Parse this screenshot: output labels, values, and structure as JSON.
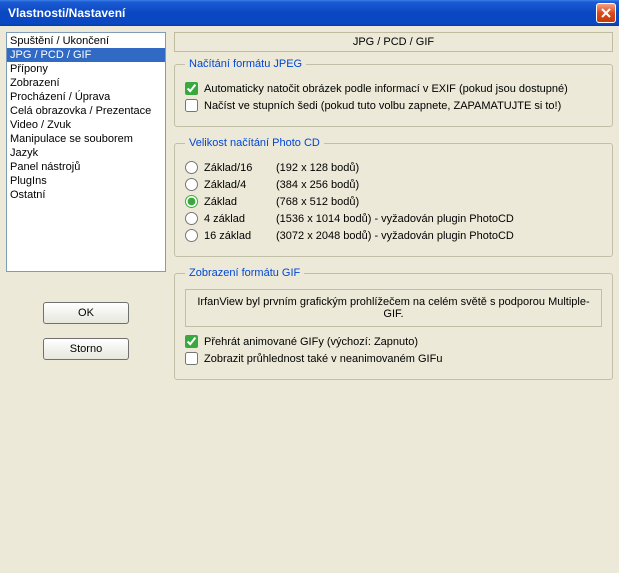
{
  "titlebar": {
    "title": "Vlastnosti/Nastavení"
  },
  "sidebar": {
    "items": [
      "Spuštění / Ukončení",
      "JPG / PCD / GIF",
      "Přípony",
      "Zobrazení",
      "Procházení / Úprava",
      "Celá obrazovka / Prezentace",
      "Video / Zvuk",
      "Manipulace se souborem",
      "Jazyk",
      "Panel nástrojů",
      "PlugIns",
      "Ostatní"
    ],
    "selected_index": 1
  },
  "buttons": {
    "ok": "OK",
    "cancel": "Storno"
  },
  "page": {
    "header": "JPG / PCD / GIF",
    "groups": {
      "jpeg": {
        "legend": "Načítání formátu JPEG",
        "auto_rotate": "Automaticky natočit obrázek podle informací v EXIF (pokud jsou dostupné)",
        "load_gray": "Načíst ve stupních šedi (pokud tuto volbu zapnete, ZAPAMATUJTE si to!)"
      },
      "pcd": {
        "legend": "Velikost načítání Photo CD",
        "options": [
          {
            "label": "Základ/16",
            "size": "(192 x 128 bodů)"
          },
          {
            "label": "Základ/4",
            "size": "(384 x 256 bodů)"
          },
          {
            "label": "Základ",
            "size": "(768 x 512 bodů)"
          },
          {
            "label": "4 základ",
            "size": "(1536 x 1014 bodů) - vyžadován plugin PhotoCD"
          },
          {
            "label": "16 základ",
            "size": "(3072 x 2048 bodů) - vyžadován plugin PhotoCD"
          }
        ],
        "selected_index": 2
      },
      "gif": {
        "legend": "Zobrazení formátu GIF",
        "info": "IrfanView byl prvním grafickým prohlížečem na celém světě s podporou Multiple-GIF.",
        "play_anim": "Přehrát animované GIFy (výchozí: Zapnuto)",
        "show_transp": "Zobrazit průhlednost také v neanimovaném GIFu"
      }
    }
  }
}
